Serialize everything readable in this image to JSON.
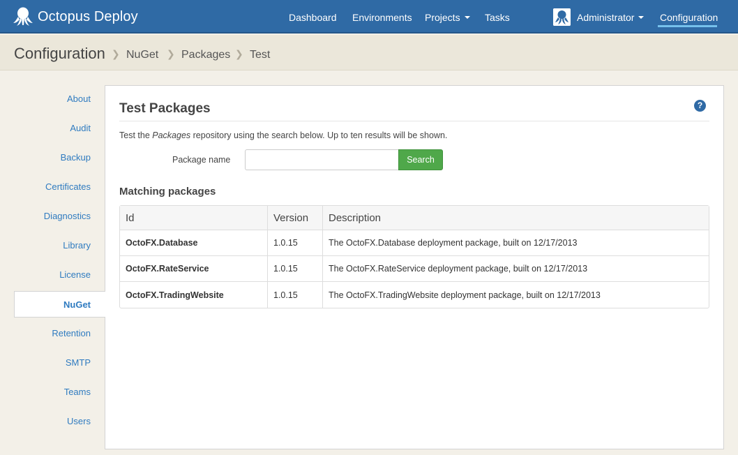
{
  "app": {
    "name": "Octopus Deploy",
    "nav": [
      {
        "label": "Dashboard",
        "dropdown": false
      },
      {
        "label": "Environments",
        "dropdown": false
      },
      {
        "label": "Projects",
        "dropdown": true
      },
      {
        "label": "Tasks",
        "dropdown": false
      }
    ],
    "user": "Administrator",
    "configuration_label": "Configuration",
    "colors": {
      "nav_bg": "#2f6aa5",
      "link": "#2f7bc0",
      "success": "#4fa84a"
    }
  },
  "breadcrumb": {
    "root": "Configuration",
    "items": [
      "NuGet",
      "Packages",
      "Test"
    ]
  },
  "sidebar": {
    "items": [
      {
        "label": "About",
        "active": false
      },
      {
        "label": "Audit",
        "active": false
      },
      {
        "label": "Backup",
        "active": false
      },
      {
        "label": "Certificates",
        "active": false
      },
      {
        "label": "Diagnostics",
        "active": false
      },
      {
        "label": "Library",
        "active": false
      },
      {
        "label": "License",
        "active": false
      },
      {
        "label": "NuGet",
        "active": true
      },
      {
        "label": "Retention",
        "active": false
      },
      {
        "label": "SMTP",
        "active": false
      },
      {
        "label": "Teams",
        "active": false
      },
      {
        "label": "Users",
        "active": false
      }
    ]
  },
  "main": {
    "title": "Test Packages",
    "help_icon": "question-circle-icon",
    "help_glyph": "?",
    "description_before": "Test the ",
    "description_em": "Packages",
    "description_after": " repository using the search below. Up to ten results will be shown.",
    "search": {
      "label": "Package name",
      "value": "",
      "placeholder": "",
      "button_label": "Search"
    },
    "results": {
      "title": "Matching packages",
      "columns": [
        "Id",
        "Version",
        "Description"
      ],
      "rows": [
        {
          "id": "OctoFX.Database",
          "version": "1.0.15",
          "description": "The OctoFX.Database deployment package, built on 12/17/2013"
        },
        {
          "id": "OctoFX.RateService",
          "version": "1.0.15",
          "description": "The OctoFX.RateService deployment package, built on 12/17/2013"
        },
        {
          "id": "OctoFX.TradingWebsite",
          "version": "1.0.15",
          "description": "The OctoFX.TradingWebsite deployment package, built on 12/17/2013"
        }
      ]
    }
  }
}
